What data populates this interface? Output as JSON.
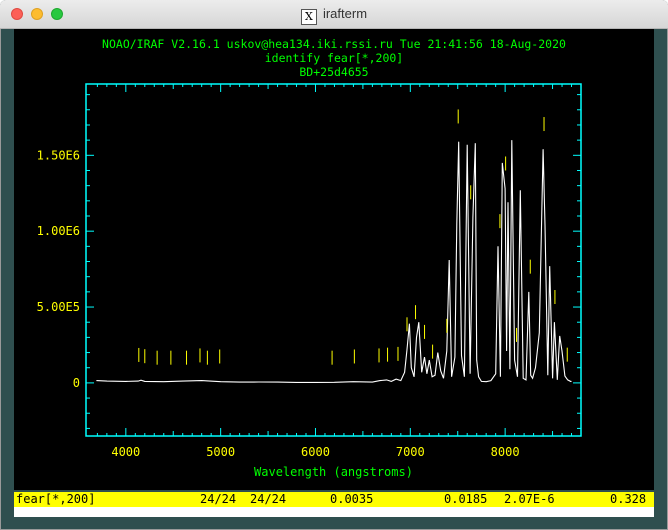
{
  "window": {
    "title": "irafterm"
  },
  "plot": {
    "header_line1": "NOAO/IRAF V2.16.1 uskov@hea134.iki.rssi.ru Tue 21:41:56 18-Aug-2020",
    "header_line2": "identify fear[*,200]",
    "header_line3": "BD+25d4655"
  },
  "statusbar": {
    "image": "fear[*,200]",
    "f1": "24/24",
    "f2": "24/24",
    "f3": "0.0035",
    "f4": "0.0185",
    "f5": "2.07E-6",
    "f6": "0.328"
  },
  "colors": {
    "frame": "#00ffff",
    "text": "#00ff00",
    "ticks": "#ffff00",
    "marks": "#ffff00",
    "spectrum": "#ffffff",
    "status": "#ffff00"
  },
  "chart_data": {
    "type": "line",
    "xlabel": "Wavelength (angstroms)",
    "ylabel": "",
    "xlim": [
      3580,
      8800
    ],
    "ylim": [
      -350000,
      1970000
    ],
    "xticks": [
      4000,
      5000,
      6000,
      7000,
      8000
    ],
    "xtick_labels": [
      "4000",
      "5000",
      "6000",
      "7000",
      "8000"
    ],
    "yticks": [
      0,
      500000,
      1000000,
      1500000
    ],
    "ytick_labels": [
      "0",
      "5.00E5",
      "1.00E6",
      "1.50E6"
    ],
    "series": [
      {
        "x": [
          3690,
          3800,
          4000,
          4130,
          4160,
          4200,
          4400,
          4600,
          4800,
          5000,
          5200,
          5400,
          5600,
          5800,
          6000,
          6200,
          6400,
          6600,
          6680,
          6750,
          6800,
          6850,
          6900,
          6940,
          6965,
          6990,
          7010,
          7040,
          7065,
          7090,
          7120,
          7150,
          7175,
          7200,
          7230,
          7260,
          7290,
          7320,
          7350,
          7385,
          7410,
          7435,
          7470,
          7490,
          7510,
          7540,
          7570,
          7600,
          7630,
          7660,
          7685,
          7700,
          7720,
          7750,
          7800,
          7850,
          7900,
          7925,
          7950,
          7970,
          8000,
          8015,
          8030,
          8050,
          8070,
          8100,
          8130,
          8160,
          8190,
          8220,
          8250,
          8270,
          8290,
          8320,
          8360,
          8400,
          8420,
          8450,
          8470,
          8500,
          8520,
          8550,
          8575,
          8600,
          8630,
          8660,
          8690,
          8700
        ],
        "y": [
          15000,
          12000,
          10000,
          12000,
          18000,
          10000,
          8000,
          12000,
          15000,
          8000,
          5000,
          6000,
          5000,
          3000,
          3000,
          4000,
          8000,
          5000,
          15000,
          20000,
          10000,
          25000,
          15000,
          70000,
          220000,
          390000,
          100000,
          40000,
          300000,
          400000,
          70000,
          170000,
          60000,
          150000,
          40000,
          50000,
          200000,
          80000,
          30000,
          210000,
          810000,
          40000,
          170000,
          1050000,
          1590000,
          180000,
          40000,
          1570000,
          60000,
          1090000,
          1580000,
          150000,
          40000,
          10000,
          8000,
          15000,
          60000,
          900000,
          40000,
          1450000,
          1280000,
          210000,
          1190000,
          90000,
          1600000,
          150000,
          40000,
          1270000,
          30000,
          20000,
          600000,
          50000,
          30000,
          100000,
          330000,
          1540000,
          1040000,
          50000,
          770000,
          30000,
          400000,
          20000,
          310000,
          210000,
          45000,
          20000,
          10000,
          10000
        ]
      }
    ],
    "line_identifications_angstrom": [
      4137,
      4200,
      4330,
      4475,
      4640,
      4782,
      4860,
      4990,
      6175,
      6410,
      6670,
      6760,
      6870,
      6965,
      7055,
      7150,
      7235,
      7385,
      7505,
      7637,
      7945,
      8005,
      8120,
      8265,
      8410,
      8525,
      8655
    ]
  }
}
